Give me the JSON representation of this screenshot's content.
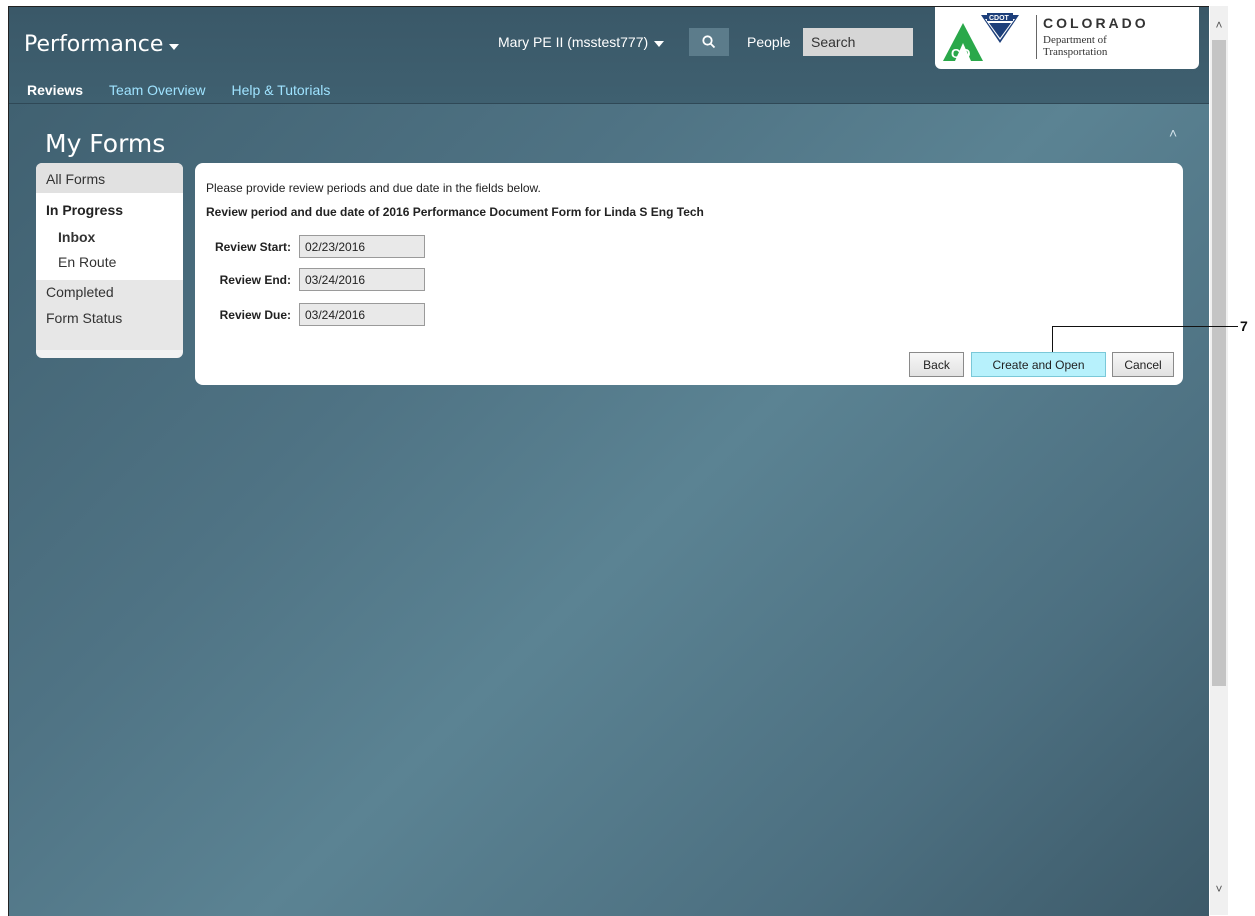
{
  "header": {
    "app_title": "Performance",
    "user": "Mary PE II (msstest777)",
    "people_label": "People",
    "search_placeholder": "Search"
  },
  "logo": {
    "badge": "CDOT",
    "state": "COLORADO",
    "dept_line1": "Department of",
    "dept_line2": "Transportation",
    "co_mark": "CO"
  },
  "nav": {
    "items": [
      {
        "label": "Reviews",
        "active": true
      },
      {
        "label": "Team Overview"
      },
      {
        "label": "Help & Tutorials"
      }
    ]
  },
  "page": {
    "title": "My Forms"
  },
  "sidebar": {
    "items": [
      {
        "label": "All Forms"
      },
      {
        "label": "In Progress"
      },
      {
        "label": "Inbox"
      },
      {
        "label": "En Route"
      },
      {
        "label": "Completed"
      },
      {
        "label": "Form Status"
      }
    ]
  },
  "form": {
    "instruction": "Please provide review periods and due date in the fields below.",
    "subtitle": "Review period and due date of 2016 Performance Document Form for Linda S Eng Tech",
    "fields": [
      {
        "label": "Review Start:",
        "value": "02/23/2016"
      },
      {
        "label": "Review End:",
        "value": "03/24/2016"
      },
      {
        "label": "Review Due:",
        "value": "03/24/2016"
      }
    ],
    "buttons": {
      "back": "Back",
      "create_open": "Create and Open",
      "cancel": "Cancel"
    }
  },
  "callout": {
    "number": "7"
  },
  "colors": {
    "accent_link": "#9fe3ff",
    "primary_button": "#b7f1fc",
    "background": "#4f7384"
  }
}
